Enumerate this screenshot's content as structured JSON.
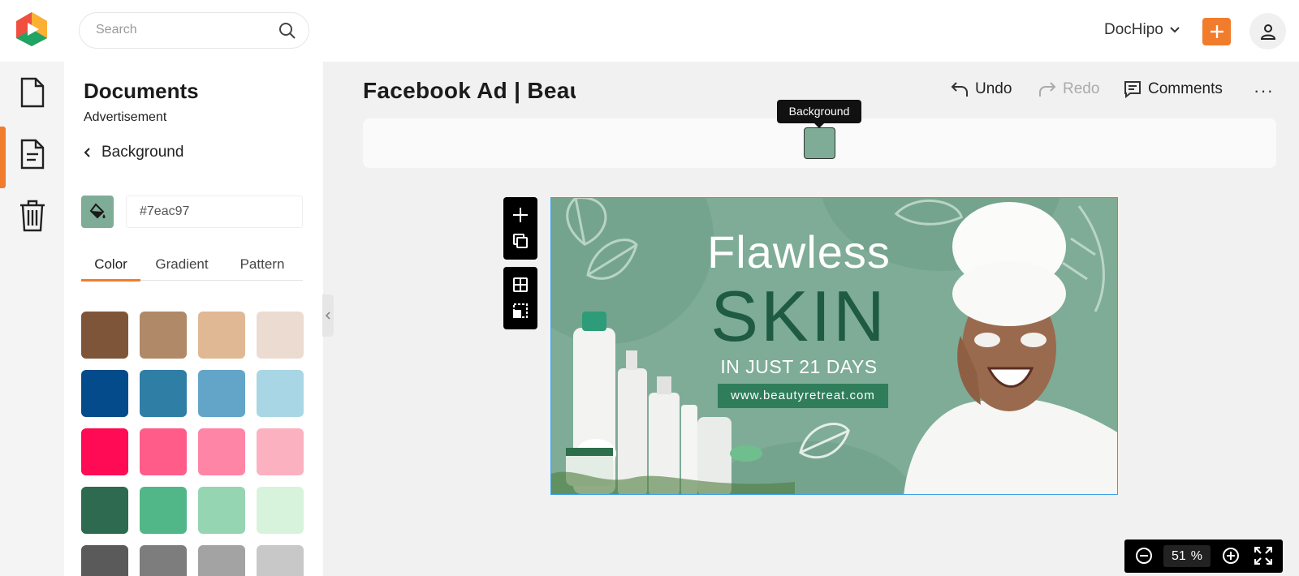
{
  "header": {
    "search_placeholder": "Search",
    "account_name": "DocHipo",
    "icons": {
      "logo": "dochipo-logo-icon",
      "search": "search-icon",
      "account_dropdown": "chevron-down-icon",
      "add": "plus-icon",
      "profile": "user-icon"
    },
    "accent_color": "#f07c2c"
  },
  "rail": {
    "items": [
      {
        "icon": "file-icon",
        "active": false
      },
      {
        "icon": "document-icon",
        "active": true
      },
      {
        "icon": "trash-icon",
        "active": false
      }
    ]
  },
  "panel": {
    "title": "Documents",
    "subtitle": "Advertisement",
    "back_label": "Background",
    "hex_value": "#7eac97",
    "current_color": "#7eac97",
    "tabs": [
      "Color",
      "Gradient",
      "Pattern"
    ],
    "active_tab": "Color",
    "swatches": [
      "#7f5539",
      "#b08968",
      "#e0b894",
      "#ebdbd1",
      "#034b8a",
      "#2f7ea6",
      "#62a5c8",
      "#a9d6e5",
      "#ff0a54",
      "#ff5c8a",
      "#ff85a6",
      "#fbb1c0",
      "#2d6a4f",
      "#52b788",
      "#95d5b2",
      "#d8f3dc",
      "#5a5a5a",
      "#7d7d7d",
      "#a3a3a3",
      "#c8c8c8"
    ]
  },
  "editor": {
    "doc_title": "Facebook Ad | Beau",
    "undo_label": "Undo",
    "redo_label": "Redo",
    "comments_label": "Comments",
    "more_label": "···",
    "tooltip": "Background",
    "zoom_value": "51",
    "zoom_unit": "%"
  },
  "ad": {
    "headline": "Flawless",
    "title": "SKIN",
    "tagline": "IN JUST 21 DAYS",
    "url": "www.beautyretreat.com",
    "background": "#7eac97",
    "title_color": "#1f5a42",
    "url_bg": "#2f7d5b"
  }
}
